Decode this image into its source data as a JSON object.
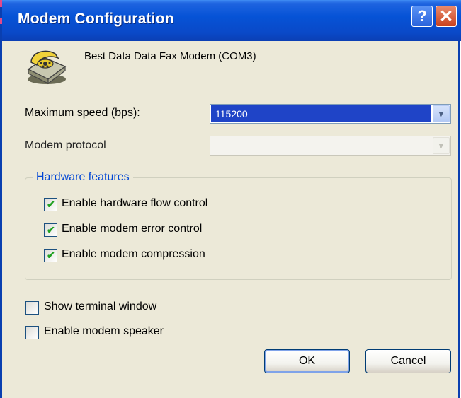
{
  "window": {
    "title": "Modem Configuration",
    "help_glyph": "?",
    "close_glyph": "✕",
    "accent": "#0a49c8"
  },
  "device": {
    "icon": "modem-phone-icon",
    "name": "Best Data Data Fax Modem (COM3)"
  },
  "form": {
    "max_speed_label": "Maximum speed (bps):",
    "max_speed_value": "115200",
    "modem_protocol_label": "Modem protocol",
    "modem_protocol_value": ""
  },
  "hardware": {
    "legend": "Hardware features",
    "items": [
      {
        "label": "Enable hardware flow control",
        "checked": true
      },
      {
        "label": "Enable modem error control",
        "checked": true
      },
      {
        "label": "Enable modem compression",
        "checked": true
      }
    ]
  },
  "options": [
    {
      "label": "Show terminal window",
      "checked": false
    },
    {
      "label": "Enable modem speaker",
      "checked": false
    }
  ],
  "buttons": {
    "ok": "OK",
    "cancel": "Cancel"
  }
}
